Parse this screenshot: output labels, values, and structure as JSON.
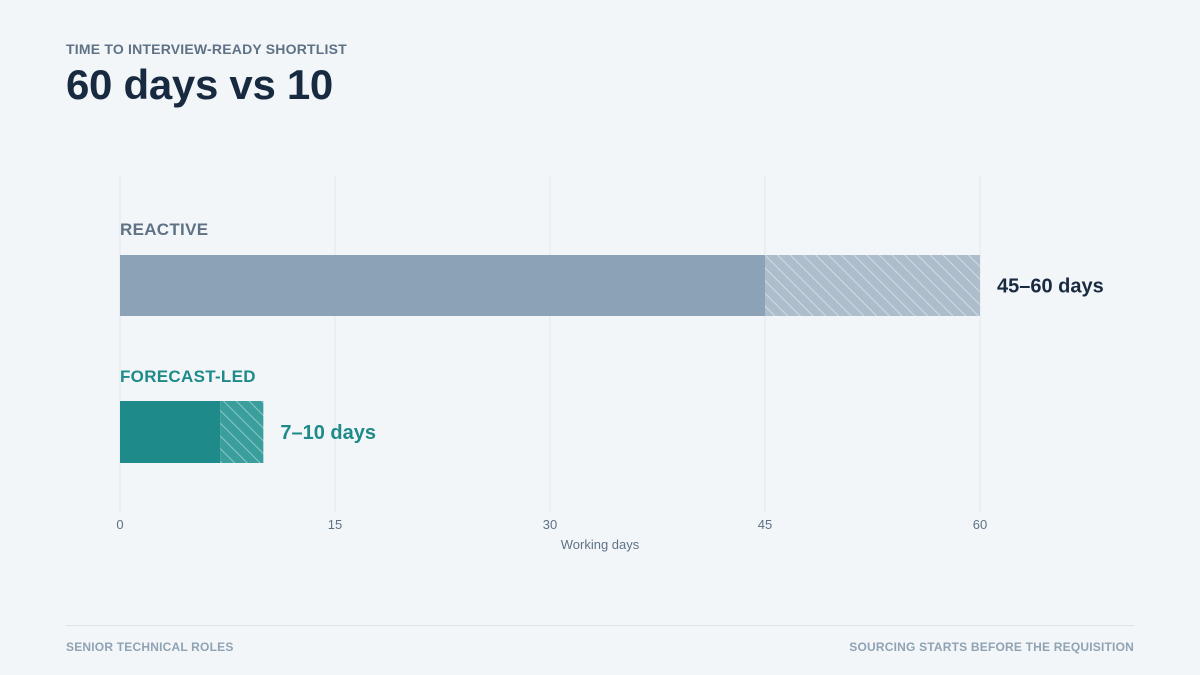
{
  "header": {
    "eyebrow": "TIME TO INTERVIEW-READY SHORTLIST",
    "title": "60 days vs 10"
  },
  "footer": {
    "left": "SENIOR TECHNICAL ROLES",
    "right": "SOURCING STARTS BEFORE THE REQUISITION"
  },
  "colors": {
    "reactive_bar": "#8ca2b7",
    "reactive_label": "#5f7285",
    "reactive_value": "#172a40",
    "forecast": "#1e8a89",
    "grid": "#e2e8ee",
    "axis_text": "#5f7285"
  },
  "chart_data": {
    "type": "bar",
    "orientation": "horizontal",
    "xlabel": "Working days",
    "xlim": [
      0,
      60
    ],
    "xticks": [
      0,
      15,
      30,
      45,
      60
    ],
    "grid": true,
    "series": [
      {
        "name": "REACTIVE",
        "min": 45,
        "max": 60,
        "range_label": "45–60 days"
      },
      {
        "name": "FORECAST-LED",
        "min": 7,
        "max": 10,
        "range_label": "7–10 days"
      }
    ]
  }
}
